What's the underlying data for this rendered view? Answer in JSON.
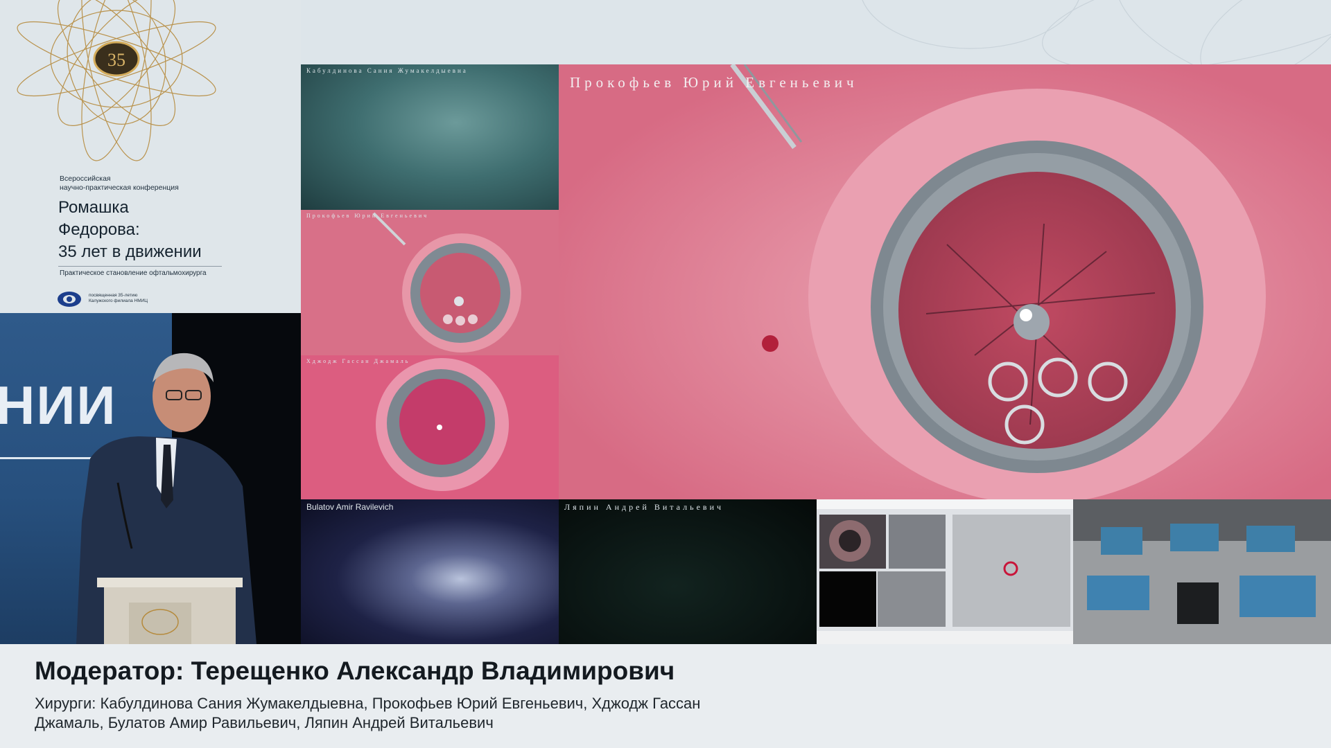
{
  "branding": {
    "logo_number": "35",
    "conference_kind_line1": "Всероссийская",
    "conference_kind_line2": "научно-практическая конференция",
    "title_line1": "Ромашка",
    "title_line2": "Федорова:",
    "title_line3": "35 лет в движении",
    "subtitle": "Практическое становление офтальмохирурга",
    "org_text_line1": "посвященная 35-летию",
    "org_text_line2": "Калужского филиала НМИЦ",
    "accent_gold": "#b58a3c"
  },
  "speaker_camera": {
    "stage_screen_text": "НИИ"
  },
  "feeds": {
    "top_left_label": "Кабулдинова Сания Жумакелдыевна",
    "middle_left_label": "Прокофьев Юрий Евгеньевич",
    "lower_left_label": "Хджодж Гассан Джамаль",
    "bottom_left_label": "Bulatov Amir Ravilevich",
    "main_label": "Прокофьев Юрий Евгеньевич",
    "bottom_middle_label": "Ляпин Андрей Витальевич",
    "imaging_panel": "imaging-navigation-screen",
    "operating_room": "operating-room-overview"
  },
  "lower_third": {
    "moderator": "Модератор: Терещенко Александр Владимирович",
    "surgeons_line1": "Хирурги: Кабулдинова Сания Жумакелдыевна, Прокофьев Юрий Евгеньевич, Хджодж Гассан",
    "surgeons_line2": "Джамаль, Булатов Амир Равильевич, Ляпин Андрей Витальевич"
  }
}
